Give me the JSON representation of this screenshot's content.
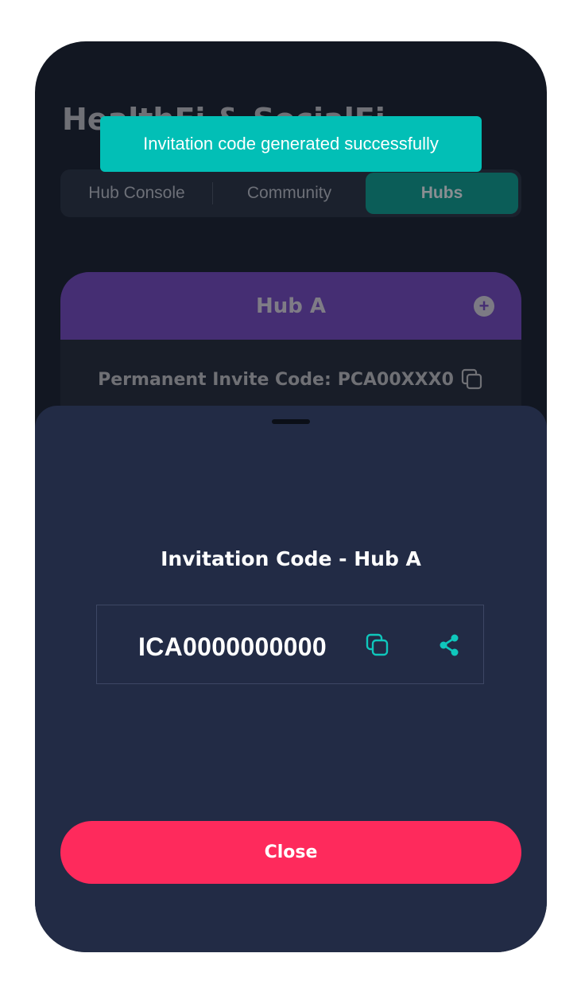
{
  "app": {
    "title": "HealthFi & SocialFi"
  },
  "tabs": [
    {
      "label": "Hub Console",
      "active": false
    },
    {
      "label": "Community",
      "active": false
    },
    {
      "label": "Hubs",
      "active": true
    }
  ],
  "hub": {
    "name": "Hub A",
    "invite_label": "Permanent Invite Code:",
    "invite_code": "PCA00XXX0",
    "add_icon": "plus-circle-icon",
    "copy_icon": "copy-icon"
  },
  "toast": {
    "message": "Invitation code generated successfully",
    "color": "#02bfb6"
  },
  "sheet": {
    "title": "Invitation Code - Hub A",
    "code": "ICA0000000000",
    "copy_icon": "copy-icon",
    "share_icon": "share-icon",
    "close_label": "Close",
    "accent": "#0fc7bc",
    "close_color": "#fe2a5c",
    "background": "#222b45"
  }
}
